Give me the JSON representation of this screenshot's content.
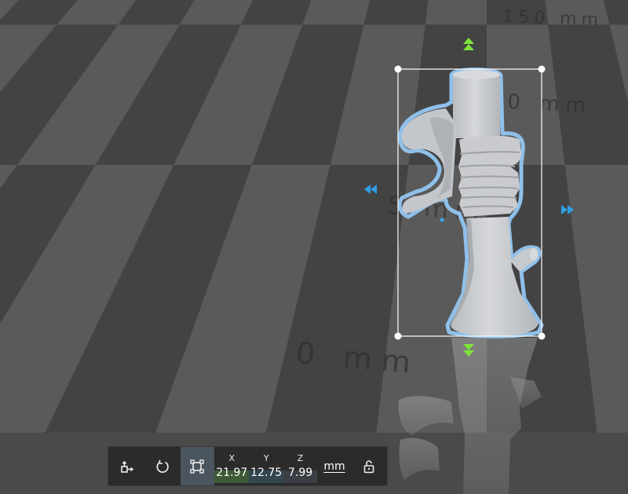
{
  "viewport": {
    "floor_labels": [
      {
        "id": "label-150",
        "text": "150 mm"
      },
      {
        "id": "label-100",
        "text": "0 mm"
      },
      {
        "id": "label-50",
        "text": "5    mm"
      },
      {
        "id": "label-0",
        "text": "0 mm"
      }
    ],
    "colors": {
      "grid_light": "#5a5a5a",
      "grid_dark": "#434343",
      "model": "#c8cbcf",
      "model_outline": "#8fc0ea",
      "gizmo_green": "#7ee33a",
      "gizmo_blue": "#2f9fe6",
      "bbox": "#ffffff"
    }
  },
  "toolbar": {
    "buttons": [
      {
        "name": "move-tool-icon",
        "active": false
      },
      {
        "name": "rotate-tool-icon",
        "active": false
      },
      {
        "name": "scale-tool-icon",
        "active": true
      }
    ],
    "coords": {
      "x": {
        "label": "X",
        "value": "21.97"
      },
      "y": {
        "label": "Y",
        "value": "12.75"
      },
      "z": {
        "label": "Z",
        "value": "7.99"
      }
    },
    "unit": "mm",
    "lock": "lock-icon"
  }
}
